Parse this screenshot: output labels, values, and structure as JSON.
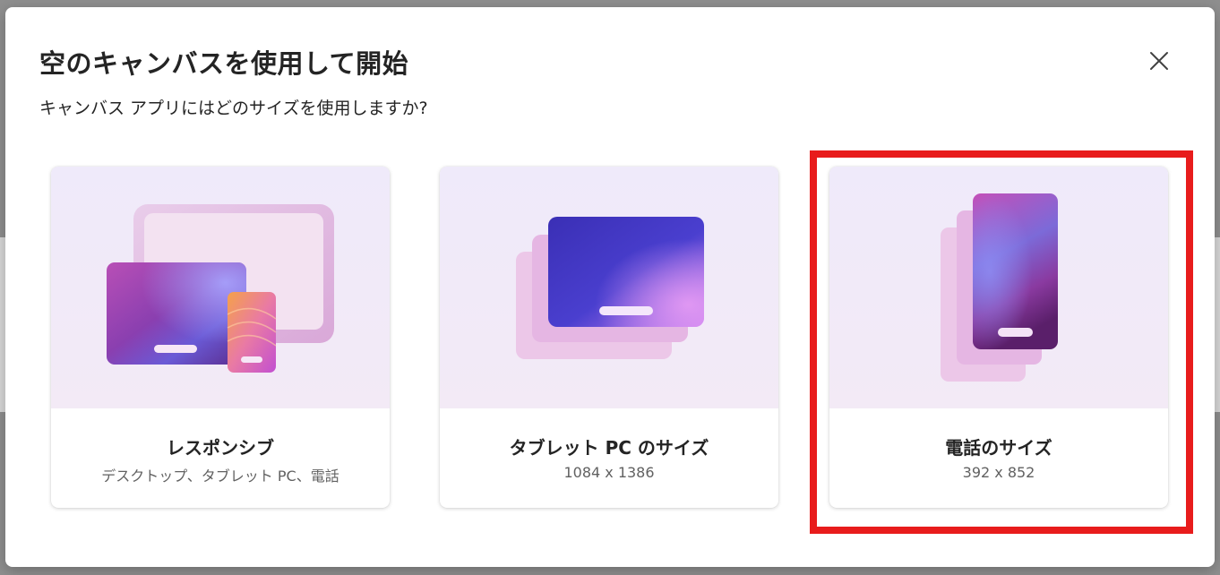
{
  "dialog": {
    "title": "空のキャンバスを使用して開始",
    "subtitle": "キャンバス アプリにはどのサイズを使用しますか?",
    "close_icon": "close-icon"
  },
  "cards": [
    {
      "id": "responsive",
      "title": "レスポンシブ",
      "subtitle": "デスクトップ、タブレット PC、電話",
      "selected": false
    },
    {
      "id": "tablet",
      "title": "タブレット PC のサイズ",
      "subtitle": "1084 x 1386",
      "selected": false
    },
    {
      "id": "phone",
      "title": "電話のサイズ",
      "subtitle": "392 x 852",
      "selected": true
    }
  ],
  "colors": {
    "highlight": "#e81c1c",
    "purple": "#7b2fa6",
    "blue": "#3a2fb5"
  }
}
